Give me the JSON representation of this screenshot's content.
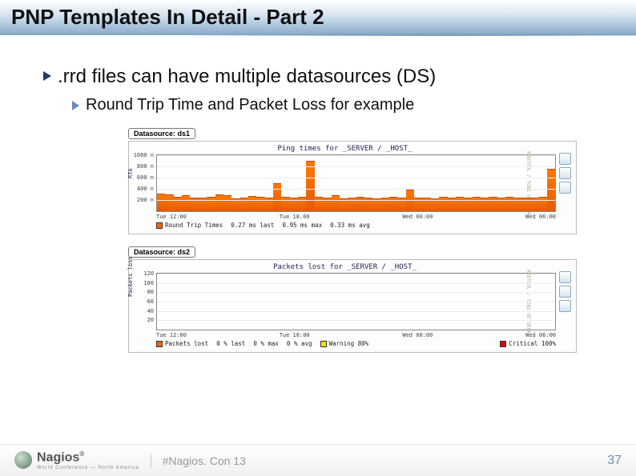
{
  "slide": {
    "title": "PNP Templates In Detail - Part 2",
    "bullet1": ".rrd files can have multiple datasources (DS)",
    "bullet2": "Round Trip Time and Packet Loss for example"
  },
  "chart_data": [
    {
      "type": "area",
      "datasource_label": "Datasource: ds1",
      "title": "Ping times for  _SERVER / _HOST_",
      "ylabel": "RTA",
      "ylim": [
        0,
        1000
      ],
      "yunit": "n",
      "yticks": [
        "200 n",
        "400 n",
        "600 n",
        "800 n",
        "1000 n"
      ],
      "categories": [
        "Tue 12:00",
        "Tue 18:00",
        "Wed 00:00",
        "Wed 06:00"
      ],
      "series": [
        {
          "name": "Round Trip Times",
          "color": "#f60",
          "values": [
            320,
            300,
            260,
            280,
            250,
            240,
            260,
            300,
            280,
            230,
            250,
            270,
            260,
            240,
            500,
            260,
            240,
            260,
            900,
            260,
            250,
            280,
            230,
            250,
            260,
            250,
            230,
            250,
            260,
            250,
            380,
            250,
            240,
            230,
            260,
            250,
            260,
            250,
            260,
            250,
            260,
            250,
            260,
            240,
            250,
            250,
            260,
            760
          ]
        }
      ],
      "legend": {
        "name": "Round Trip Times",
        "last": "0.27 ms last",
        "max": "0.95 ms max",
        "avg": "0.33 ms avg"
      },
      "watermark": "RRDTOOL / TOBI OETIKER"
    },
    {
      "type": "area",
      "datasource_label": "Datasource: ds2",
      "title": "Packets lost for  _SERVER / _HOST_",
      "ylabel": "Packets lost",
      "ylim": [
        0,
        120
      ],
      "yticks": [
        "20",
        "40",
        "60",
        "80",
        "100",
        "120"
      ],
      "categories": [
        "Tue 12:00",
        "Tue 18:00",
        "Wed 00:00",
        "Wed 06:00"
      ],
      "series": [
        {
          "name": "Packets lost",
          "color": "#f60",
          "values": [
            0,
            0,
            0,
            0,
            0,
            0,
            0,
            0,
            0,
            0,
            0,
            0,
            0,
            0,
            0,
            0,
            0,
            0,
            0,
            0,
            0,
            0,
            0,
            0,
            0,
            0,
            0,
            0,
            0,
            0,
            0,
            0,
            0,
            0,
            0,
            0
          ]
        }
      ],
      "legend": {
        "name": "Packets lost",
        "last": "0 % last",
        "max": "0 % max",
        "avg": "0 % avg",
        "warn": "Warning 80%",
        "crit": "Critical 100%"
      },
      "watermark": "RRDTOOL / TOBI OETIKER"
    }
  ],
  "footer": {
    "logo": "Nagios",
    "logo_sub": "World Conference — North America",
    "hashtag": "#Nagios. Con 13",
    "page": "37"
  }
}
